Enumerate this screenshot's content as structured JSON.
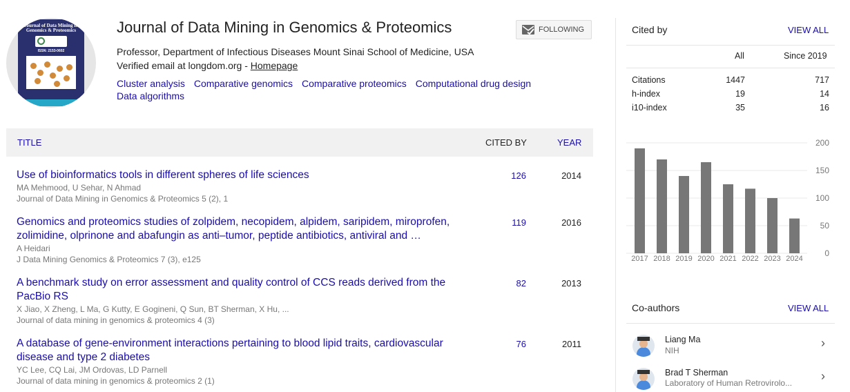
{
  "profile": {
    "name": "Journal of Data Mining in Genomics & Proteomics",
    "follow_label": "FOLLOWING",
    "affiliation": "Professor, Department of Infectious Diseases Mount Sinai School of Medicine, USA",
    "email_text": "Verified email at longdom.org - ",
    "homepage_label": "Homepage",
    "interests": [
      "Cluster analysis",
      "Comparative genomics",
      "Comparative proteomics",
      "Computational drug design",
      "Data algorithms"
    ],
    "cover_title": "Journal of Data Mining in Genomics & Proteomics",
    "cover_issn": "ISSN: 2153-0602"
  },
  "table": {
    "headers": {
      "title": "TITLE",
      "cited_by": "CITED BY",
      "year": "YEAR"
    },
    "rows": [
      {
        "title": "Use of bioinformatics tools in different spheres of life sciences",
        "authors": "MA Mehmood, U Sehar, N Ahmad",
        "venue": "Journal of Data Mining in Genomics & Proteomics 5 (2), 1",
        "cited_by": "126",
        "year": "2014"
      },
      {
        "title": "Genomics and proteomics studies of zolpidem, necopidem, alpidem, saripidem, miroprofen, zolimidine, olprinone and abafungin as anti–tumor, peptide antibiotics, antiviral and …",
        "authors": "A Heidari",
        "venue": "J Data Mining Genomics & Proteomics 7 (3), e125",
        "cited_by": "119",
        "year": "2016"
      },
      {
        "title": "A benchmark study on error assessment and quality control of CCS reads derived from the PacBio RS",
        "authors": "X Jiao, X Zheng, L Ma, G Kutty, E Gogineni, Q Sun, BT Sherman, X Hu, ...",
        "venue": "Journal of data mining in genomics & proteomics 4 (3)",
        "cited_by": "82",
        "year": "2013"
      },
      {
        "title": "A database of gene-environment interactions pertaining to blood lipid traits, cardiovascular disease and type 2 diabetes",
        "authors": "YC Lee, CQ Lai, JM Ordovas, LD Parnell",
        "venue": "Journal of data mining in genomics & proteomics 2 (1)",
        "cited_by": "76",
        "year": "2011"
      }
    ]
  },
  "cited_by": {
    "title": "Cited by",
    "view_all": "VIEW ALL",
    "col_all": "All",
    "col_since": "Since 2019",
    "stats": [
      {
        "label": "Citations",
        "all": "1447",
        "since": "717"
      },
      {
        "label": "h-index",
        "all": "19",
        "since": "14"
      },
      {
        "label": "i10-index",
        "all": "35",
        "since": "16"
      }
    ]
  },
  "chart_data": {
    "type": "bar",
    "categories": [
      "2017",
      "2018",
      "2019",
      "2020",
      "2021",
      "2022",
      "2023",
      "2024"
    ],
    "values": [
      190,
      170,
      140,
      165,
      125,
      117,
      100,
      63
    ],
    "y_ticks": [
      "200",
      "150",
      "100",
      "50",
      "0"
    ],
    "ylim": [
      0,
      200
    ],
    "bar_color": "#777777"
  },
  "coauthors": {
    "title": "Co-authors",
    "view_all": "VIEW ALL",
    "items": [
      {
        "name": "Liang Ma",
        "affiliation": "NIH"
      },
      {
        "name": "Brad T Sherman",
        "affiliation": "Laboratory of Human Retrovirolo..."
      }
    ]
  }
}
